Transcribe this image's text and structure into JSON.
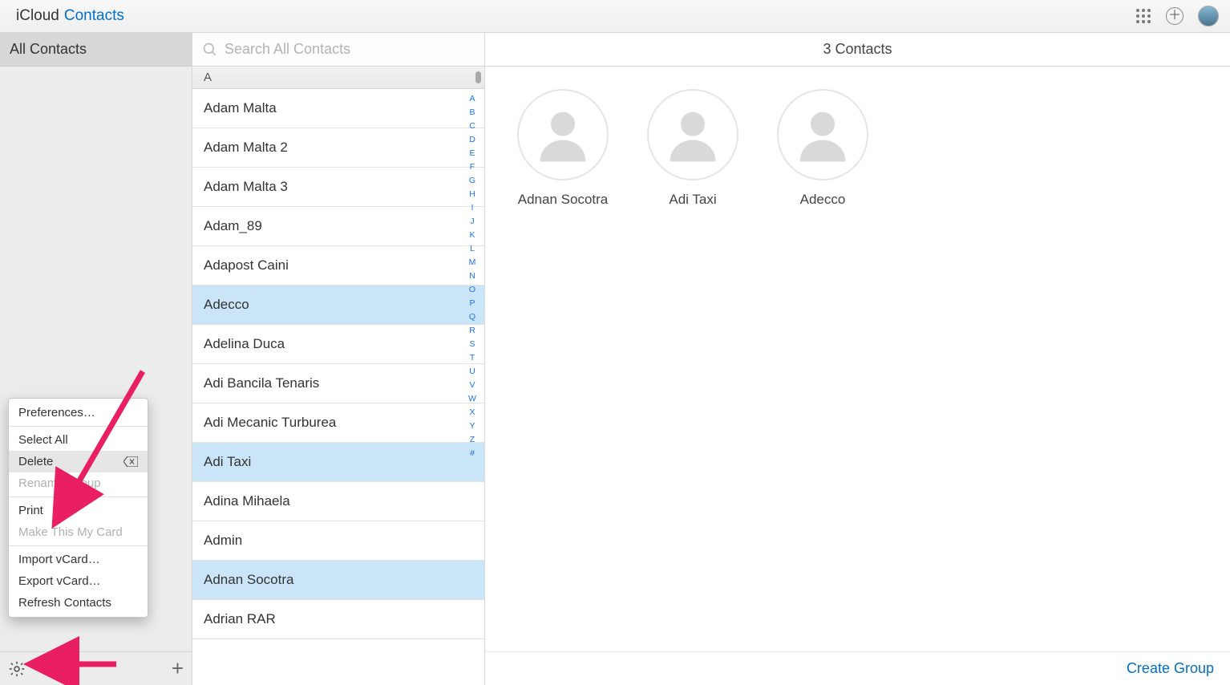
{
  "header": {
    "apple_glyph": "",
    "icloud_label": "iCloud",
    "contacts_label": "Contacts"
  },
  "sidebar": {
    "all_contacts": "All Contacts"
  },
  "search": {
    "placeholder": "Search All Contacts"
  },
  "section_letter": "A",
  "contacts": [
    {
      "name": "Adam Malta",
      "selected": false
    },
    {
      "name": "Adam Malta 2",
      "selected": false
    },
    {
      "name": "Adam Malta 3",
      "selected": false
    },
    {
      "name": "Adam_89",
      "selected": false
    },
    {
      "name": "Adapost Caini",
      "selected": false
    },
    {
      "name": "Adecco",
      "selected": true
    },
    {
      "name": "Adelina Duca",
      "selected": false
    },
    {
      "name": "Adi Bancila Tenaris",
      "selected": false
    },
    {
      "name": "Adi Mecanic Turburea",
      "selected": false
    },
    {
      "name": "Adi Taxi",
      "selected": true
    },
    {
      "name": "Adina Mihaela",
      "selected": false
    },
    {
      "name": "Admin",
      "selected": false
    },
    {
      "name": "Adnan Socotra",
      "selected": true
    },
    {
      "name": "Adrian RAR",
      "selected": false
    }
  ],
  "alpha_index": [
    "A",
    "B",
    "C",
    "D",
    "E",
    "F",
    "G",
    "H",
    "I",
    "J",
    "K",
    "L",
    "M",
    "N",
    "O",
    "P",
    "Q",
    "R",
    "S",
    "T",
    "U",
    "V",
    "W",
    "X",
    "Y",
    "Z",
    "#"
  ],
  "detail": {
    "header": "3 Contacts",
    "cards": [
      {
        "name": "Adnan Socotra"
      },
      {
        "name": "Adi Taxi"
      },
      {
        "name": "Adecco"
      }
    ],
    "create_group": "Create Group"
  },
  "menu": {
    "preferences": "Preferences…",
    "select_all": "Select All",
    "delete": "Delete",
    "rename_group": "Rename Group",
    "print": "Print",
    "make_my_card": "Make This My Card",
    "import_vcard": "Import vCard…",
    "export_vcard": "Export vCard…",
    "refresh": "Refresh Contacts"
  }
}
